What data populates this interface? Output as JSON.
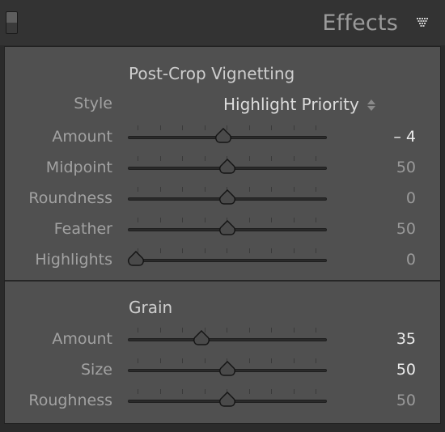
{
  "header": {
    "title": "Effects"
  },
  "vignette": {
    "title": "Post-Crop Vignetting",
    "style_label": "Style",
    "style_value": "Highlight Priority",
    "sliders": [
      {
        "label": "Amount",
        "value": "– 4",
        "pos": 0.48,
        "active": true
      },
      {
        "label": "Midpoint",
        "value": "50",
        "pos": 0.5,
        "active": false
      },
      {
        "label": "Roundness",
        "value": "0",
        "pos": 0.5,
        "active": false
      },
      {
        "label": "Feather",
        "value": "50",
        "pos": 0.5,
        "active": false
      },
      {
        "label": "Highlights",
        "value": "0",
        "pos": 0.0,
        "active": false
      }
    ]
  },
  "grain": {
    "title": "Grain",
    "sliders": [
      {
        "label": "Amount",
        "value": "35",
        "pos": 0.36,
        "active": true
      },
      {
        "label": "Size",
        "value": "50",
        "pos": 0.5,
        "active": true
      },
      {
        "label": "Roughness",
        "value": "50",
        "pos": 0.5,
        "active": false
      }
    ]
  }
}
